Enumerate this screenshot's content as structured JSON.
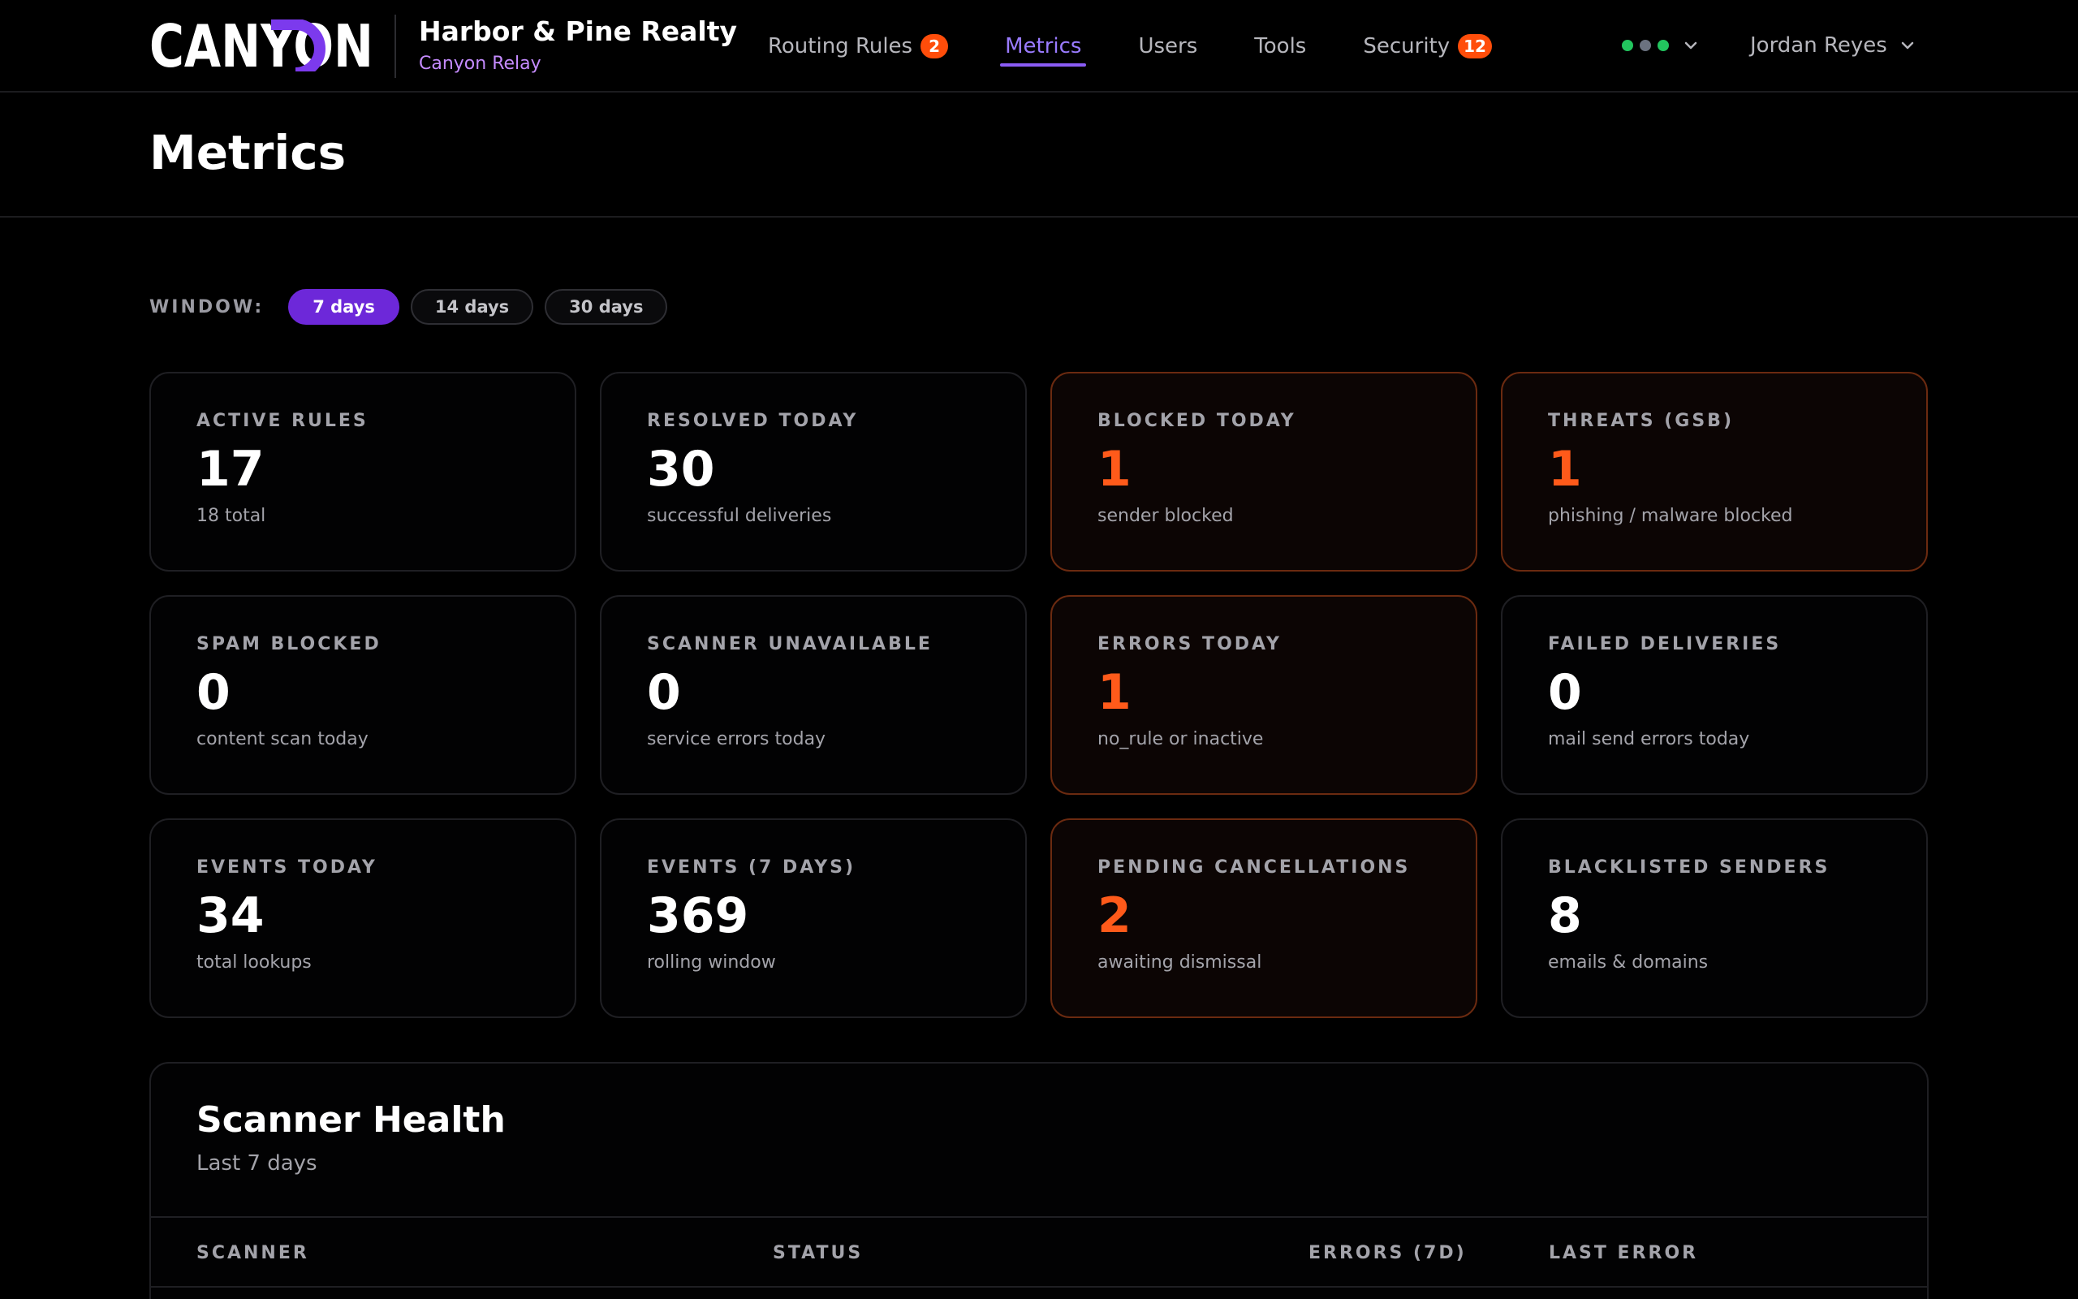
{
  "brand": {
    "logo_text": "CANYON",
    "org_name": "Harbor & Pine Realty",
    "product_name": "Canyon Relay",
    "logo_accent": "#7c3aed"
  },
  "nav": {
    "items": [
      {
        "label": "Routing Rules",
        "badge": "2",
        "active": false
      },
      {
        "label": "Metrics",
        "active": true
      },
      {
        "label": "Users",
        "active": false
      },
      {
        "label": "Tools",
        "active": false
      },
      {
        "label": "Security",
        "badge": "12",
        "active": false
      }
    ]
  },
  "status_dots": [
    "#22c55e",
    "#6b7280",
    "#22c55e"
  ],
  "user": {
    "name": "Jordan Reyes"
  },
  "page": {
    "title": "Metrics"
  },
  "window": {
    "label": "WINDOW:",
    "options": [
      "7 days",
      "14 days",
      "30 days"
    ],
    "selected": "7 days"
  },
  "cards": [
    {
      "label": "Active Rules",
      "value": "17",
      "sub": "18 total",
      "alert": false
    },
    {
      "label": "Resolved Today",
      "value": "30",
      "sub": "successful deliveries",
      "alert": false
    },
    {
      "label": "Blocked Today",
      "value": "1",
      "sub": "sender blocked",
      "alert": true
    },
    {
      "label": "Threats (GSB)",
      "value": "1",
      "sub": "phishing / malware blocked",
      "alert": true
    },
    {
      "label": "Spam Blocked",
      "value": "0",
      "sub": "content scan today",
      "alert": false
    },
    {
      "label": "Scanner Unavailable",
      "value": "0",
      "sub": "service errors today",
      "alert": false
    },
    {
      "label": "Errors Today",
      "value": "1",
      "sub": "no_rule or inactive",
      "alert": true
    },
    {
      "label": "Failed Deliveries",
      "value": "0",
      "sub": "mail send errors today",
      "alert": false
    },
    {
      "label": "Events Today",
      "value": "34",
      "sub": "total lookups",
      "alert": false
    },
    {
      "label": "Events (7 Days)",
      "value": "369",
      "sub": "rolling window",
      "alert": false
    },
    {
      "label": "Pending Cancellations",
      "value": "2",
      "sub": "awaiting dismissal",
      "alert": true
    },
    {
      "label": "Blacklisted Senders",
      "value": "8",
      "sub": "emails & domains",
      "alert": false
    }
  ],
  "scanner_health": {
    "title": "Scanner Health",
    "subtitle": "Last 7 days",
    "columns": [
      "SCANNER",
      "STATUS",
      "ERRORS (7D)",
      "LAST ERROR"
    ]
  },
  "colors": {
    "accent": "#8b5cf6",
    "alert": "#ff5a1a",
    "badge": "#ff4d0a",
    "background": "#000000"
  }
}
